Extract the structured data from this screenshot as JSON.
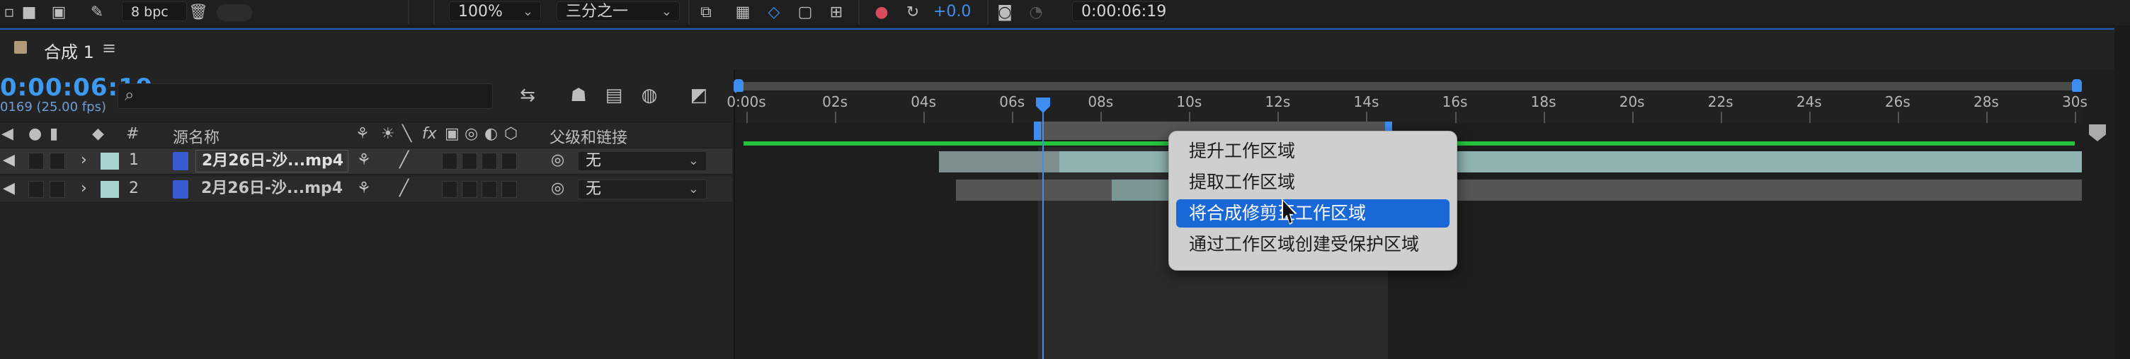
{
  "toolbar": {
    "bpc": "8 bpc",
    "zoom": "100%",
    "resolution": "三分之一",
    "exposure": "+0.0",
    "timecode": "0:00:06:19"
  },
  "comp_tab": {
    "label": "合成 1",
    "menu_glyph": "≡"
  },
  "left": {
    "current_time": "0:00:06:19",
    "frame_info": "0169 (25.00 fps)",
    "search_placeholder": ""
  },
  "columns": {
    "number": "#",
    "source_name": "源名称",
    "parent_link": "父级和链接"
  },
  "layers": [
    {
      "index": "1",
      "name": "2月26日-沙...mp4",
      "parent": "无"
    },
    {
      "index": "2",
      "name": "2月26日-沙...mp4",
      "parent": "无"
    }
  ],
  "ruler": {
    "ticks": [
      "0:00s",
      "02s",
      "04s",
      "06s",
      "08s",
      "10s",
      "12s",
      "14s",
      "16s",
      "18s",
      "20s",
      "22s",
      "24s",
      "26s",
      "28s",
      "30s"
    ]
  },
  "context_menu": {
    "items": [
      "提升工作区域",
      "提取工作区域",
      "将合成修剪至工作区域",
      "通过工作区域创建受保护区域"
    ],
    "highlighted_index": 2
  },
  "colors": {
    "accent": "#3d8ef0",
    "menu_highlight": "#1a68d8",
    "work_area_green": "#23c33c",
    "label_aqua": "#a6d2cf"
  }
}
